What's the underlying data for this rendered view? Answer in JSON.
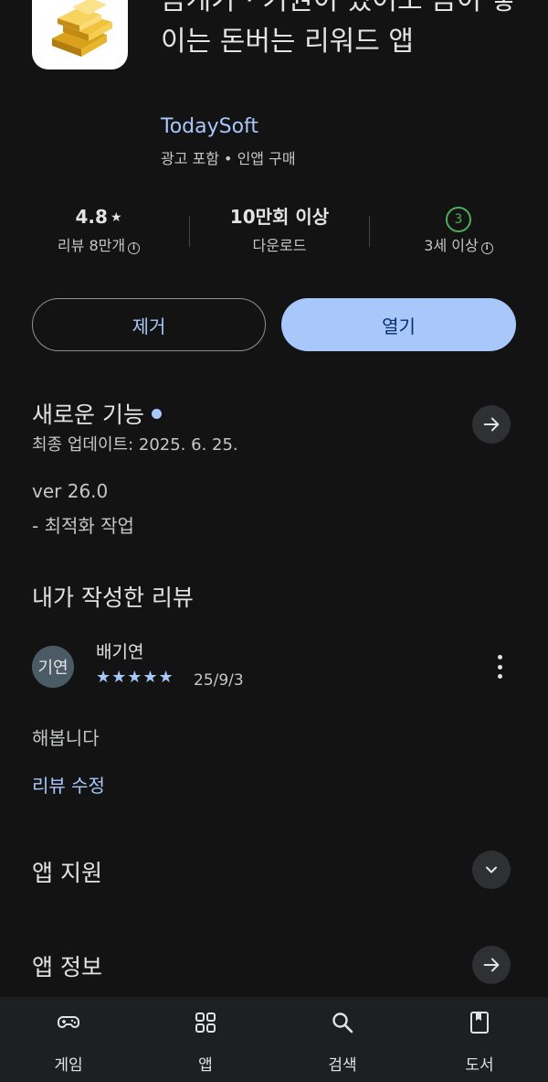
{
  "app": {
    "title": "금게가 · 기권이 있어도 금이 쌓이는 돈버는 리워드 앱",
    "developer": "TodaySoft",
    "tags": "광고 포함  •  인앱 구매"
  },
  "stats": {
    "rating": "4.8",
    "rating_star": "★",
    "reviews": "리뷰 8만개",
    "downloads": "10만회 이상",
    "downloads_label": "다운로드",
    "age_badge": "3",
    "age_label": "3세 이상"
  },
  "buttons": {
    "remove": "제거",
    "open": "열기"
  },
  "whats_new": {
    "title": "새로운 기능",
    "updated": "최종 업데이트: 2025. 6. 25.",
    "line1": "ver 26.0",
    "line2": "- 최적화 작업"
  },
  "my_review": {
    "title": "내가 작성한 리뷰",
    "avatar_text": "기연",
    "name": "배기연",
    "stars": "★★★★★",
    "rating_value": 5,
    "date": "25/9/3",
    "text": "해봅니다",
    "edit_link": "리뷰 수정"
  },
  "sections": {
    "support": "앱 지원",
    "info": "앱 정보"
  },
  "nav": [
    {
      "label": "게임",
      "icon": "gamepad-icon"
    },
    {
      "label": "앱",
      "icon": "apps-grid-icon"
    },
    {
      "label": "검색",
      "icon": "search-icon"
    },
    {
      "label": "도서",
      "icon": "book-icon"
    }
  ],
  "colors": {
    "background": "#131314",
    "accent": "#a8c7fa",
    "age_green": "#4cae56"
  }
}
